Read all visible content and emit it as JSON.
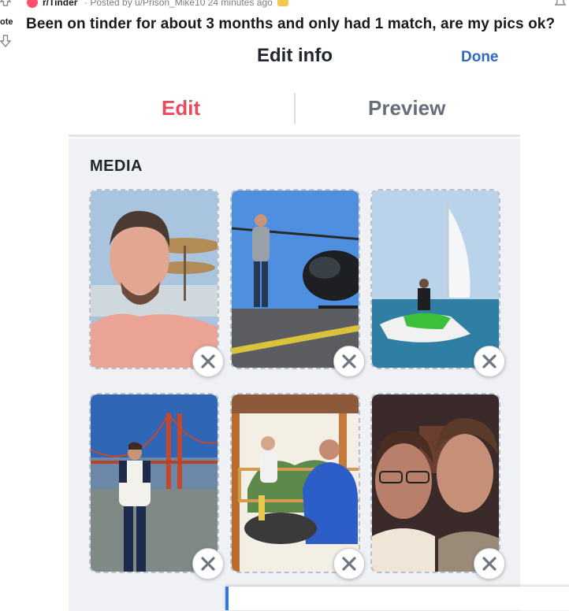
{
  "reddit": {
    "subreddit": "r/Tinder",
    "posted_meta": "· Posted by u/Prison_Mike10 24 minutes ago",
    "vote_label": "ote",
    "post_title": "Been on tinder for about 3 months and only had 1 match, are my pics ok?"
  },
  "screen": {
    "title": "Edit info",
    "done_label": "Done",
    "tabs": [
      {
        "label": "Edit",
        "active": true
      },
      {
        "label": "Preview",
        "active": false
      }
    ],
    "section_heading": "MEDIA",
    "photos": [
      {
        "subject": "selfie-beach-umbrella"
      },
      {
        "subject": "helicopter-pad"
      },
      {
        "subject": "jet-ski-burj-al-arab"
      },
      {
        "subject": "golden-gate-bridge"
      },
      {
        "subject": "restaurant-with-man"
      },
      {
        "subject": "selfie-with-friend"
      }
    ]
  },
  "colors": {
    "accent_edit": "#e94b5b",
    "done_blue": "#2c6bc7",
    "tab_inactive": "#656e7b",
    "panel_bg": "#f0f1f4"
  },
  "icons": {
    "remove": "close-icon",
    "upvote": "arrow-up-icon",
    "downvote": "arrow-down-icon",
    "notifications": "bell-icon"
  },
  "toast": {
    "text": ""
  }
}
